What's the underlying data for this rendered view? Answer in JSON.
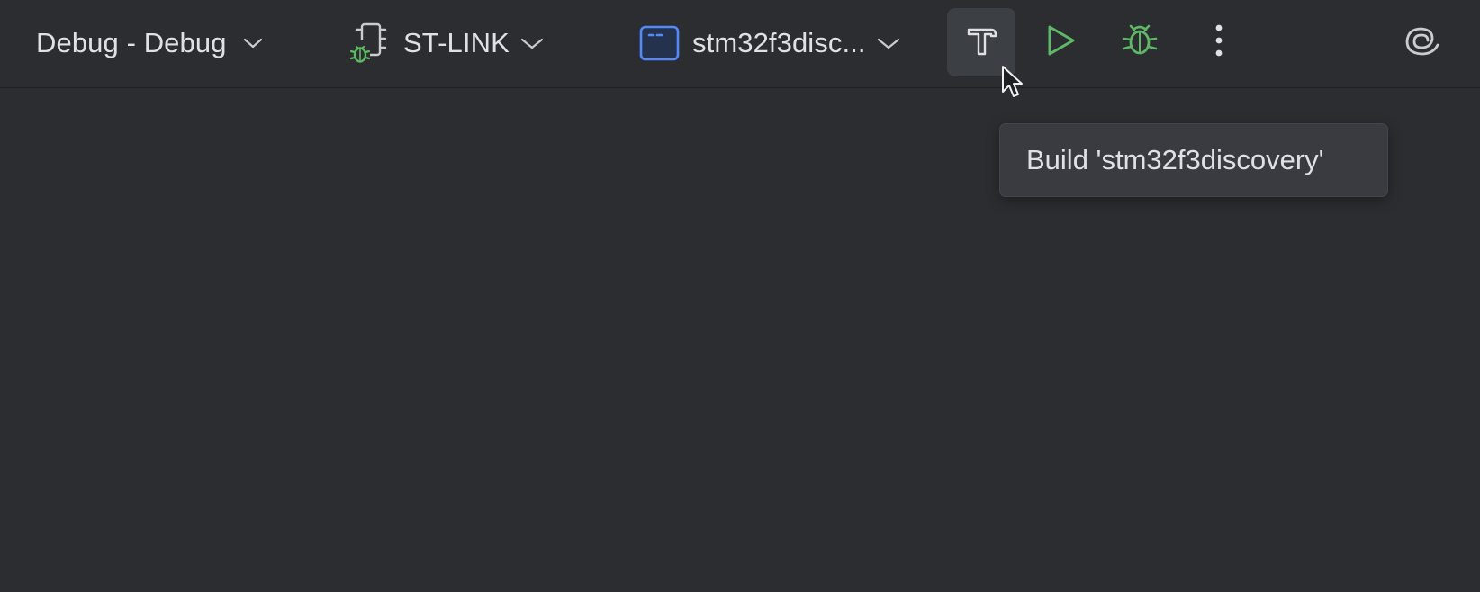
{
  "toolbar": {
    "build_config": {
      "label": "Debug - Debug",
      "icon": "chevron-down-icon"
    },
    "debug_probe": {
      "label": "ST-LINK",
      "icon": "chip-debug-icon"
    },
    "run_target": {
      "label": "stm32f3disc...",
      "icon": "window-target-icon"
    },
    "actions": [
      {
        "name": "build",
        "icon": "hammer-icon"
      },
      {
        "name": "run",
        "icon": "play-icon"
      },
      {
        "name": "debug",
        "icon": "bug-icon"
      },
      {
        "name": "more",
        "icon": "more-vertical-icon"
      },
      {
        "name": "ai-assistant",
        "icon": "spiral-icon"
      }
    ]
  },
  "tooltip": {
    "text": "Build 'stm32f3discovery'"
  },
  "colors": {
    "background": "#2b2d30",
    "text": "#dfe1e5",
    "run_green": "#5fb865",
    "target_blue": "#548af7",
    "hover_bg": "#3c3f44",
    "tooltip_bg": "#393b40"
  }
}
